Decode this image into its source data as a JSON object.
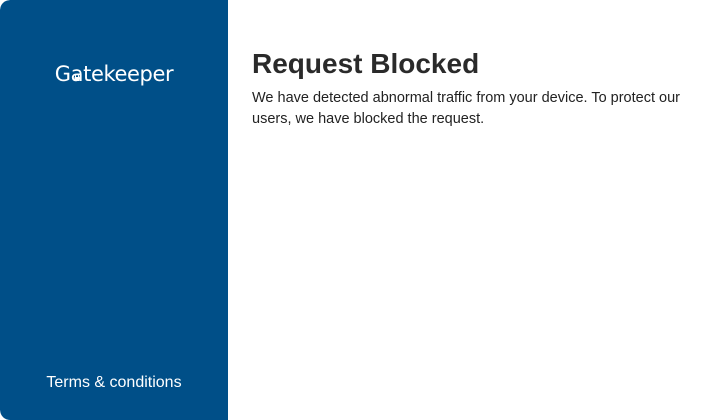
{
  "brand": {
    "prefix": "G",
    "lock_char": "a",
    "suffix": "tekeeper",
    "lock_icon": "padlock-icon",
    "sidebar_color": "#004f88"
  },
  "sidebar": {
    "terms_label": "Terms & conditions"
  },
  "main": {
    "title": "Request Blocked",
    "message": "We have detected abnormal traffic from your device. To protect our users, we have blocked the request."
  }
}
